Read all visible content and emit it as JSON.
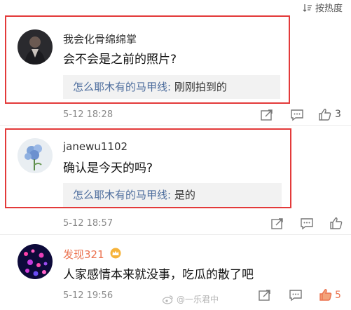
{
  "header": {
    "sort_label": "按热度",
    "sort_icon": "sort-icon"
  },
  "comments": [
    {
      "username": "我会化骨绵绵掌",
      "text": "会不会是之前的照片?",
      "reply": {
        "user": "怎么耶木有的马甲线",
        "separator": ":",
        "text": "刚刚拍到的"
      },
      "time": "5-12 18:28",
      "likes": "3",
      "highlighted": true
    },
    {
      "username": "janewu1102",
      "text": "确认是今天的吗?",
      "reply": {
        "user": "怎么耶木有的马甲线",
        "separator": ":",
        "text": "是的"
      },
      "time": "5-12 18:57",
      "likes": "",
      "highlighted": true
    },
    {
      "username": "发现321",
      "text": "人家感情本来就没事，吃瓜的散了吧",
      "time": "5-12 19:56",
      "likes": "5",
      "highlighted": false
    }
  ],
  "watermark": "@一乐君中",
  "colors": {
    "highlight_border": "#e33a3a",
    "reply_user": "#4e6e9e",
    "liked_orange": "#eb7350",
    "vip_name_orange": "#eb7350"
  }
}
